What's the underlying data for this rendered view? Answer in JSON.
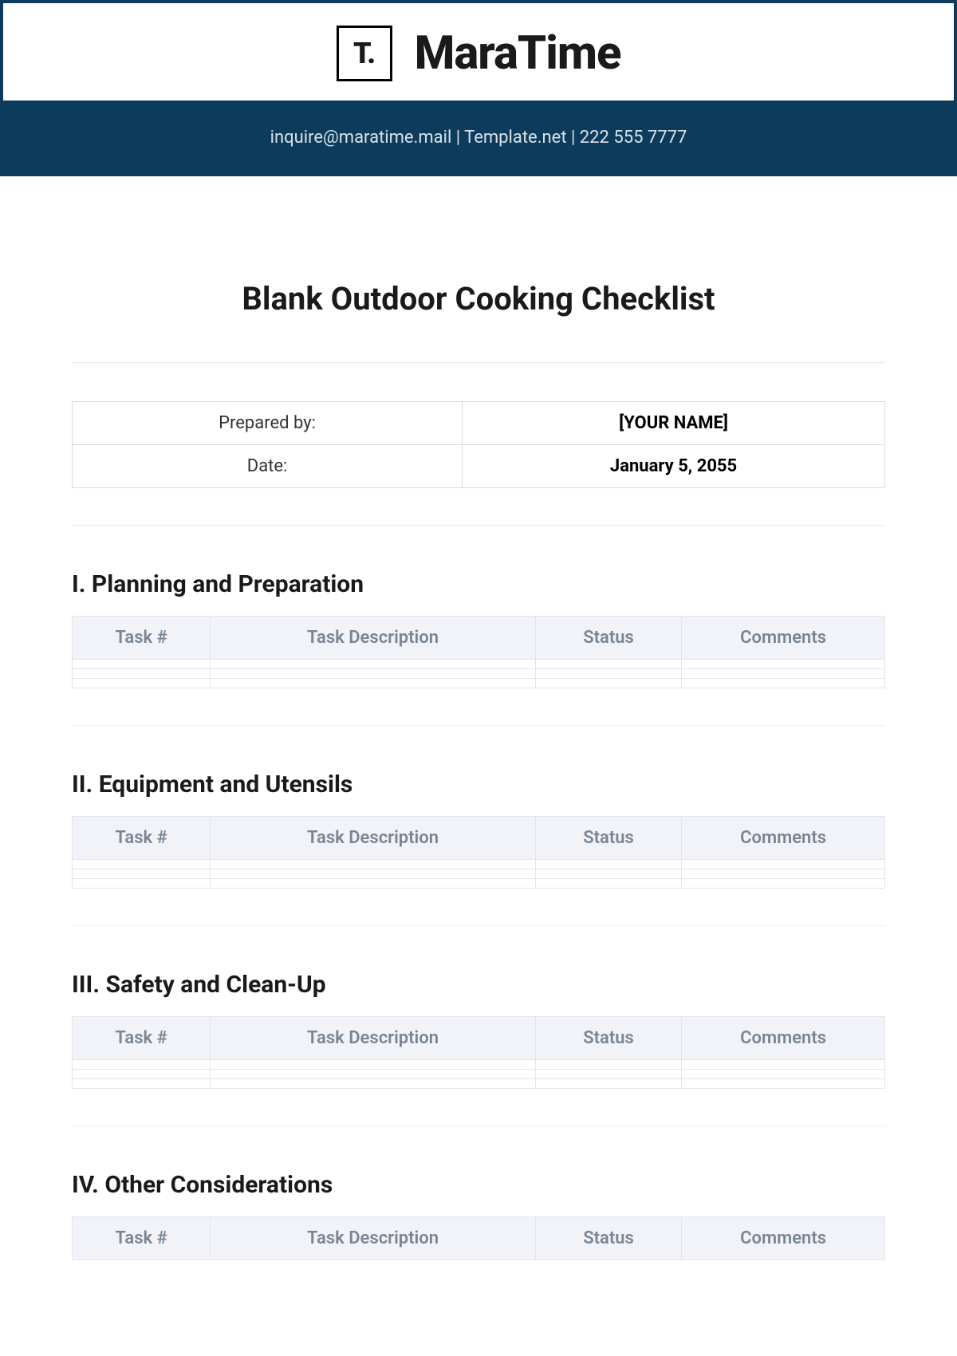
{
  "header": {
    "logo_text": "T.",
    "brand": "MaraTime",
    "contact_line": "inquire@maratime.mail | Template.net | 222 555 7777"
  },
  "document": {
    "title": "Blank Outdoor Cooking Checklist",
    "meta": {
      "prepared_by_label": "Prepared by:",
      "prepared_by_value": "[YOUR NAME]",
      "date_label": "Date:",
      "date_value": "January 5, 2055"
    }
  },
  "columns": {
    "task_num": "Task #",
    "task_desc": "Task Description",
    "status": "Status",
    "comments": "Comments"
  },
  "sections": [
    {
      "heading": "I. Planning and Preparation"
    },
    {
      "heading": "II. Equipment and Utensils"
    },
    {
      "heading": "III. Safety and Clean-Up"
    },
    {
      "heading": "IV. Other Considerations"
    }
  ]
}
